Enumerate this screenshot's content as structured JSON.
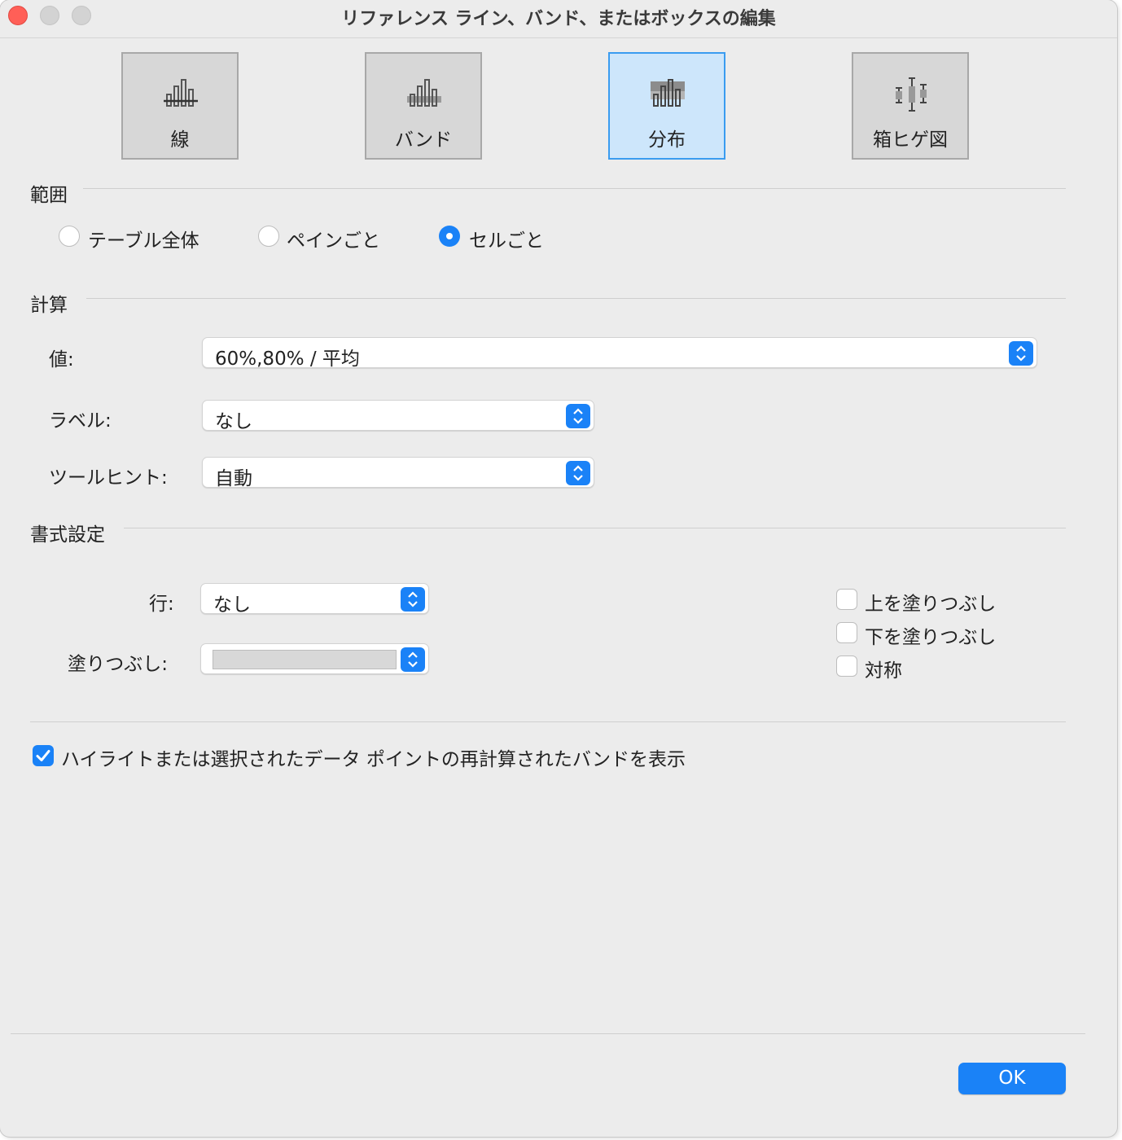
{
  "window": {
    "title": "リファレンス ライン、バンド、またはボックスの編集"
  },
  "types": [
    {
      "label": "線",
      "icon": "line-chart-icon",
      "selected": false
    },
    {
      "label": "バンド",
      "icon": "band-chart-icon",
      "selected": false
    },
    {
      "label": "分布",
      "icon": "distribution-chart-icon",
      "selected": true
    },
    {
      "label": "箱ヒゲ図",
      "icon": "box-plot-icon",
      "selected": false
    }
  ],
  "scope": {
    "label": "範囲",
    "options": [
      {
        "label": "テーブル全体",
        "selected": false
      },
      {
        "label": "ペインごと",
        "selected": false
      },
      {
        "label": "セルごと",
        "selected": true
      }
    ]
  },
  "calculation": {
    "label": "計算",
    "value_label": "値:",
    "value": "60%,80% / 平均",
    "label_label": "ラベル:",
    "label_value": "なし",
    "tooltip_label": "ツールヒント:",
    "tooltip_value": "自動"
  },
  "formatting": {
    "label": "書式設定",
    "line_label": "行:",
    "line_value": "なし",
    "fill_label": "塗りつぶし:",
    "fill_color": "#d8d8d8",
    "fill_above": {
      "label": "上を塗りつぶし",
      "checked": false
    },
    "fill_below": {
      "label": "下を塗りつぶし",
      "checked": false
    },
    "symmetric": {
      "label": "対称",
      "checked": false
    }
  },
  "recalc": {
    "label": "ハイライトまたは選択されたデータ ポイントの再計算されたバンドを表示",
    "checked": true
  },
  "ok_label": "OK",
  "colors": {
    "accent": "#1a82f7",
    "selected_bg": "#cde6fb",
    "close": "#ff5f57"
  }
}
